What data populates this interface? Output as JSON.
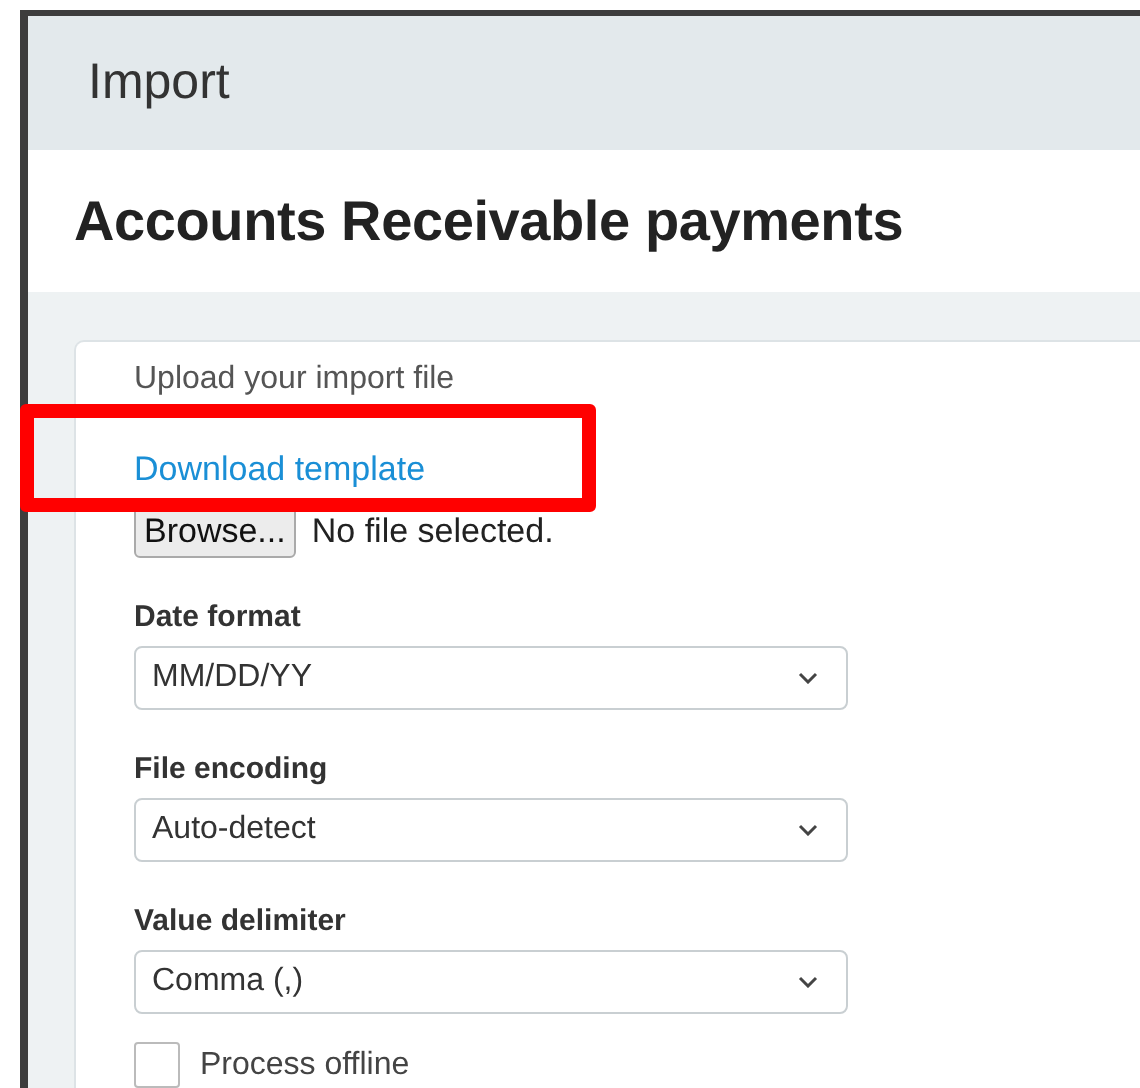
{
  "header": {
    "title": "Import"
  },
  "page_title": "Accounts Receivable payments",
  "form": {
    "upload_label": "Upload your import file",
    "template_link": "Download template",
    "browse_button": "Browse...",
    "file_status": "No file selected.",
    "selects": [
      {
        "label": "Date format",
        "value": "MM/DD/YY"
      },
      {
        "label": "File encoding",
        "value": "Auto-detect"
      },
      {
        "label": "Value delimiter",
        "value": "Comma (,)"
      }
    ],
    "process_offline": {
      "label": "Process offline",
      "checked": false
    }
  },
  "annotation": {
    "kind": "box"
  }
}
